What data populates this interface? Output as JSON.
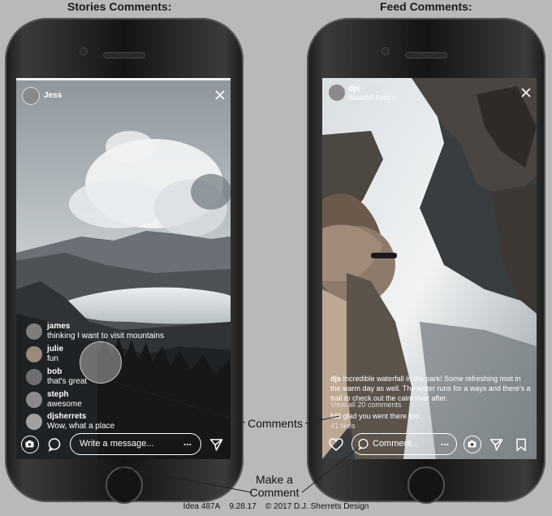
{
  "headers": {
    "left": "Stories Comments:",
    "right": "Feed Comments:"
  },
  "stories": {
    "user": "Jess",
    "comments": [
      {
        "user": "james",
        "text": "thinking I want to visit mountains"
      },
      {
        "user": "julie",
        "text": "fun"
      },
      {
        "user": "bob",
        "text": "that's great"
      },
      {
        "user": "steph",
        "text": "awesome"
      },
      {
        "user": "djsherrets",
        "text": "Wow, what a place"
      }
    ],
    "message_placeholder": "Write a message...",
    "more_label": "..."
  },
  "feed": {
    "user": "djs",
    "time": "33m",
    "location": "Waterfall Point >",
    "caption_user": "djs",
    "caption_text": "Incredible waterfall in the park! Some refreshing mist in the warm day as well. The water runs for a ways and there's a trail to check out the calm river after.",
    "view_all": "View all 20 comments",
    "comment_user": "bill",
    "comment_text": "glad you went there too",
    "likes": "41 likes",
    "comment_placeholder": "Comment...",
    "more_label": "..."
  },
  "callouts": {
    "comments": "Comments",
    "make_comment": "Make a Comment"
  },
  "footer": {
    "idea": "Idea 487A",
    "date": "9.28.17",
    "copyright": "© 2017 D.J. Sherrets Design"
  }
}
